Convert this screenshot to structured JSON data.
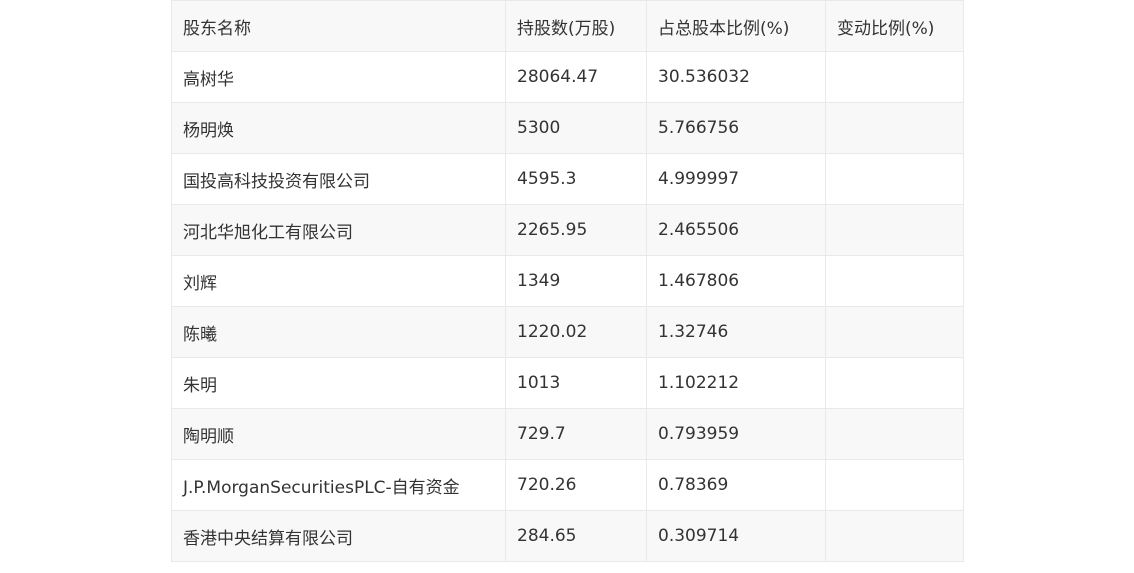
{
  "table": {
    "headers": [
      "股东名称",
      "持股数(万股)",
      "占总股本比例(%)",
      "变动比例(%)"
    ],
    "rows": [
      [
        "高树华",
        "28064.47",
        "30.536032",
        ""
      ],
      [
        "杨明焕",
        "5300",
        "5.766756",
        ""
      ],
      [
        "国投高科技投资有限公司",
        "4595.3",
        "4.999997",
        ""
      ],
      [
        "河北华旭化工有限公司",
        "2265.95",
        "2.465506",
        ""
      ],
      [
        "刘辉",
        "1349",
        "1.467806",
        ""
      ],
      [
        "陈曦",
        "1220.02",
        "1.32746",
        ""
      ],
      [
        "朱明",
        "1013",
        "1.102212",
        ""
      ],
      [
        "陶明顺",
        "729.7",
        "0.793959",
        ""
      ],
      [
        "J.P.MorganSecuritiesPLC-自有资金",
        "720.26",
        "0.78369",
        ""
      ],
      [
        "香港中央结算有限公司",
        "284.65",
        "0.309714",
        ""
      ]
    ]
  }
}
